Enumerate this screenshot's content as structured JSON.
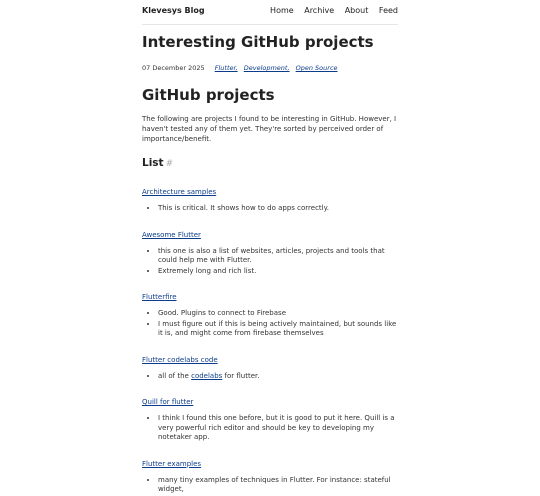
{
  "nav": {
    "brand": "Klevesys Blog",
    "links": [
      "Home",
      "Archive",
      "About",
      "Feed"
    ]
  },
  "post": {
    "title": "Interesting GitHub projects",
    "date": "07 December 2025",
    "tags": [
      "Flutter,",
      "Development,",
      "Open Source"
    ],
    "section_title": "GitHub projects",
    "intro": "The following are projects I found to be interesting in GitHub. However, I haven't tested any of them yet. They're sorted by perceived order of importance/benefit.",
    "list_heading": "List",
    "list_anchor": "#",
    "projects": [
      {
        "name": "Architecture samples",
        "notes": [
          "This is critical. It shows how to do apps correctly."
        ]
      },
      {
        "name": "Awesome Flutter",
        "notes": [
          "this one is also a list of websites, articles, projects and tools that could help me with Flutter.",
          "Extremely long and rich list."
        ]
      },
      {
        "name": "Flutterfire",
        "notes": [
          "Good. Plugins to connect to Firebase",
          "I must figure out if this is being actively maintained, but sounds like it is, and might come from firebase themselves"
        ]
      },
      {
        "name": "Flutter codelabs code",
        "notes_pre": "all of the ",
        "notes_link": "codelabs",
        "notes_post": " for flutter."
      },
      {
        "name": "Quill for flutter",
        "notes": [
          "I think I found this one before, but it is good to put it here. Quill is a very powerful rich editor and should be key to developing my notetaker app."
        ]
      },
      {
        "name": "Flutter examples",
        "notes": [
          "many tiny examples of techniques in Flutter. For instance: stateful widget,"
        ]
      }
    ]
  }
}
